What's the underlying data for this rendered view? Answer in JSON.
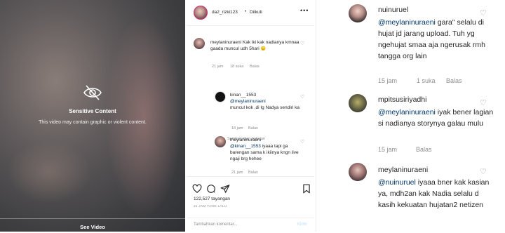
{
  "video": {
    "sensitive_title": "Sensitive Content",
    "sensitive_desc": "This video may contain graphic or violent content.",
    "see_video": "See Video"
  },
  "post": {
    "username": "da2_rizki123",
    "dot": "•",
    "follow_status": "Diikuti",
    "more": "•••",
    "comment1": {
      "user": "meylaninuraeni",
      "text": " Kak iki kak nadianya kmnaa gaada muncul udh 5hari",
      "emoji": "😑",
      "time": "21 jam",
      "likes": "18 suka",
      "reply": "Balas",
      "heart": "♡"
    },
    "hide_replies": "Sembunyikan balasan",
    "reply1": {
      "user": "kinan__1553",
      "mention": "@meylaninuraeni",
      "text": "muncul kok ,di Ig Nadya sendiri ka",
      "time": "18 jam",
      "reply": "Balas",
      "heart": "♡"
    },
    "reply2": {
      "user": "meylaninuraeni",
      "mention": "@kinan__1553",
      "text": " iyaaa tapi ga barengan sama k ikiinya kngn live ngaji brg hehee",
      "time": "21 jam",
      "reply": "Balas",
      "heart": "♡"
    },
    "views": "122,527 tayangan",
    "time_ago": "21 JAM YANG LALU",
    "add_comment_placeholder": "Tambahkan komentar...",
    "send_label": "Kirim"
  },
  "right": {
    "comments": [
      {
        "user": "nuinuruel",
        "mention": "@meylaninuraeni",
        "text": " gara\" selalu di hujat jd jarang upload. Tuh yg ngehujat smaa aja ngerusak rmh tangga org lain",
        "time": "15 jam",
        "likes": "1 suka",
        "reply": "Balas",
        "heart": "♡"
      },
      {
        "user": "mpitsusiriyadhi",
        "mention": "@meylaninuraeni",
        "text": " iyak bener lagian si nadianya storynya galau mulu",
        "time": "15 jam",
        "likes": "",
        "reply": "Balas",
        "heart": "♡"
      },
      {
        "user": "meylaninuraeni",
        "mention": "@nuinuruel",
        "text": " iyaaa bner kak kasian ya, mdh2an kak Nadia selalu d kasih kekuatan hujatan2 netizen",
        "time": "",
        "likes": "",
        "reply": "",
        "heart": "♡"
      }
    ]
  }
}
